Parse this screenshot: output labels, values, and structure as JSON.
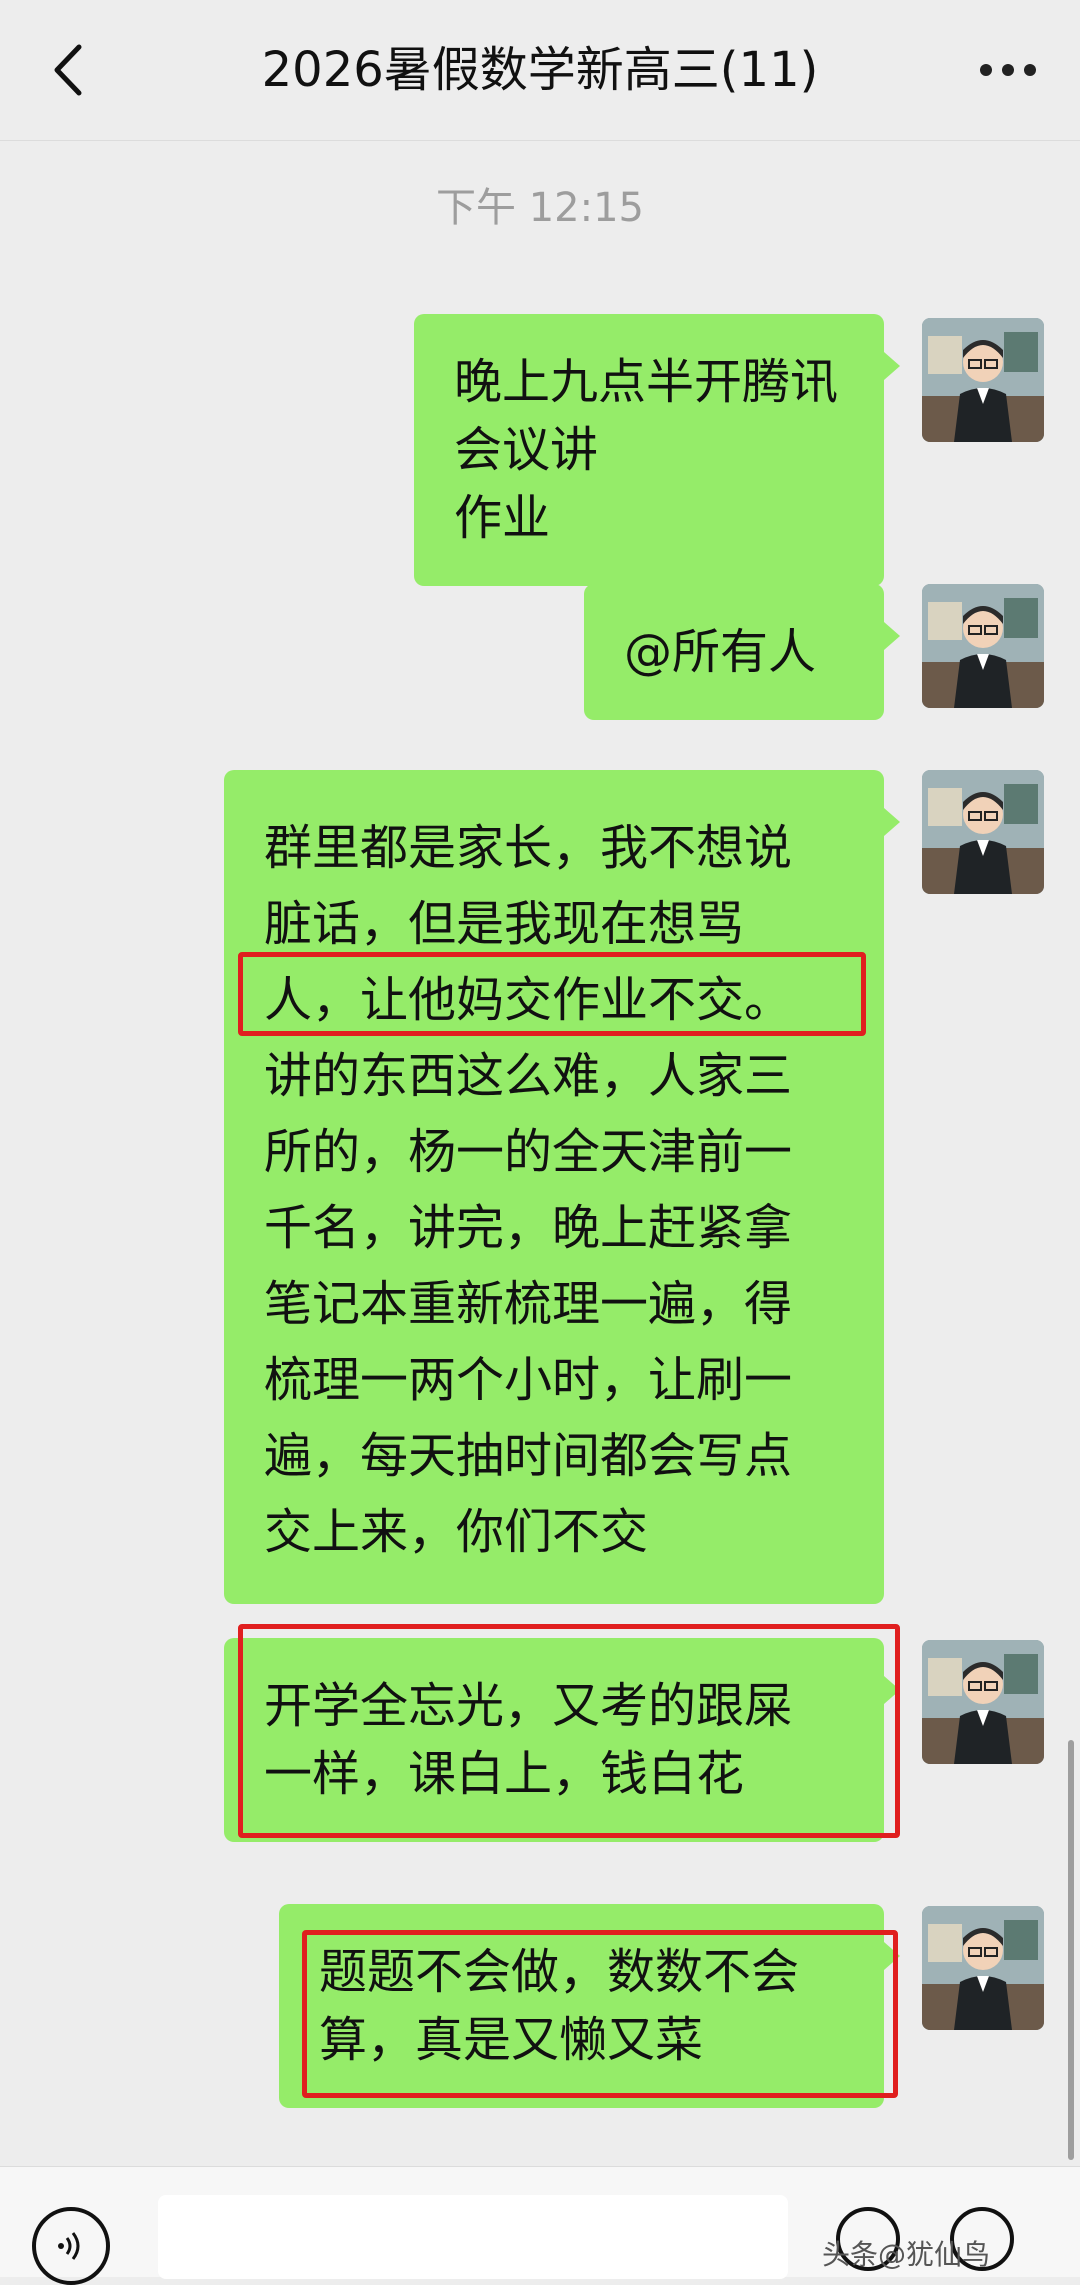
{
  "header": {
    "title": "2026暑假数学新高三(11)",
    "back_icon": "chevron-left-icon",
    "more_icon": "more-horizontal-icon"
  },
  "timestamp": "下午 12:15",
  "messages": [
    {
      "text": "晚上九点半开腾讯会议讲\n作业"
    },
    {
      "text": "@所有人"
    },
    {
      "text": "群里都是家长，我不想说\n脏话，但是我现在想骂\n人，让他妈交作业不交。\n讲的东西这么难，人家三\n所的，杨一的全天津前一\n千名，讲完，晚上赶紧拿\n笔记本重新梳理一遍，得\n梳理一两个小时，让刷一\n遍，每天抽时间都会写点\n交上来，你们不交"
    },
    {
      "text": "开学全忘光，又考的跟屎\n一样，课白上，钱白花"
    },
    {
      "text": "题题不会做，数数不会\n算，真是又懒又菜"
    }
  ],
  "footer": {
    "watermark": "头条@犹仙鸟",
    "voice_icon": "voice-icon",
    "emoji_icon": "emoji-icon",
    "plus_icon": "plus-icon"
  },
  "colors": {
    "bubble": "#95ec69",
    "background": "#ededed",
    "highlight": "#e01f1f"
  }
}
